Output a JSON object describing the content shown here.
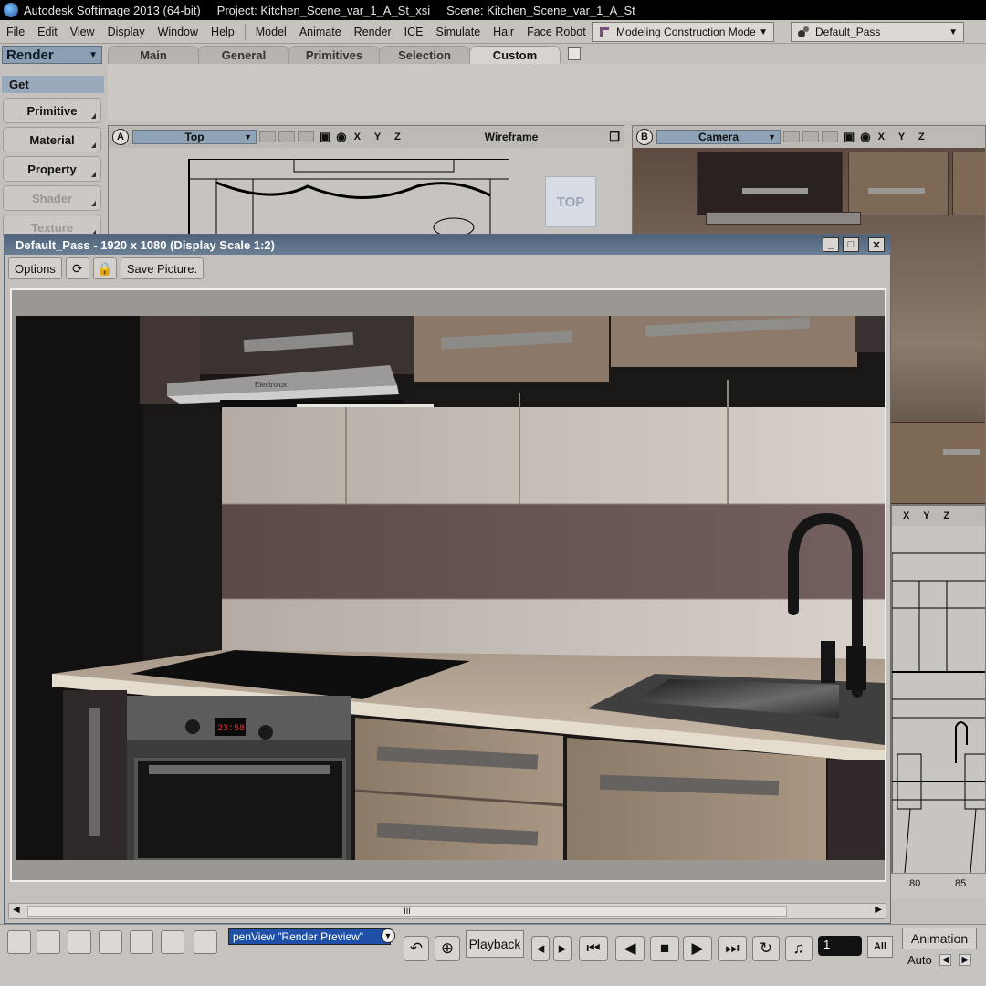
{
  "titlebar": {
    "app": "Autodesk Softimage 2013 (64-bit)",
    "project": "Project: Kitchen_Scene_var_1_A_St_xsi",
    "scene": "Scene: Kitchen_Scene_var_1_A_St"
  },
  "menu": [
    "File",
    "Edit",
    "View",
    "Display",
    "Window",
    "Help",
    "Model",
    "Animate",
    "Render",
    "ICE",
    "Simulate",
    "Hair",
    "Face Robot"
  ],
  "mode": "Modeling Construction Mode",
  "pass": "Default_Pass",
  "left_panel": {
    "module": "Render",
    "get_label": "Get",
    "buttons": [
      "Primitive",
      "Material",
      "Property",
      "Shader",
      "Texture"
    ]
  },
  "tabs": [
    "Main",
    "General",
    "Primitives",
    "Selection",
    "Custom"
  ],
  "viewport_a": {
    "letter": "A",
    "view": "Top",
    "axes": "X Y Z",
    "display": "Wireframe",
    "cube_label": "TOP"
  },
  "viewport_b": {
    "letter": "B",
    "view": "Camera",
    "axes": "X Y Z"
  },
  "viewport_d": {
    "axes": "X Y Z"
  },
  "ruler": [
    "80",
    "85"
  ],
  "render_window": {
    "title": "Default_Pass -  1920 x 1080 (Display Scale 1:2)",
    "options_label": "Options",
    "save_label": "Save Picture.",
    "oven_display": "23:58",
    "hood_brand": "Electrolux",
    "scroll_grip": "III"
  },
  "timeline": {
    "script_text": "penView \"Render Preview\"",
    "playback_label": "Playback",
    "frame": "1",
    "all_label": "All",
    "animation_label": "Animation",
    "auto_label": "Auto"
  }
}
